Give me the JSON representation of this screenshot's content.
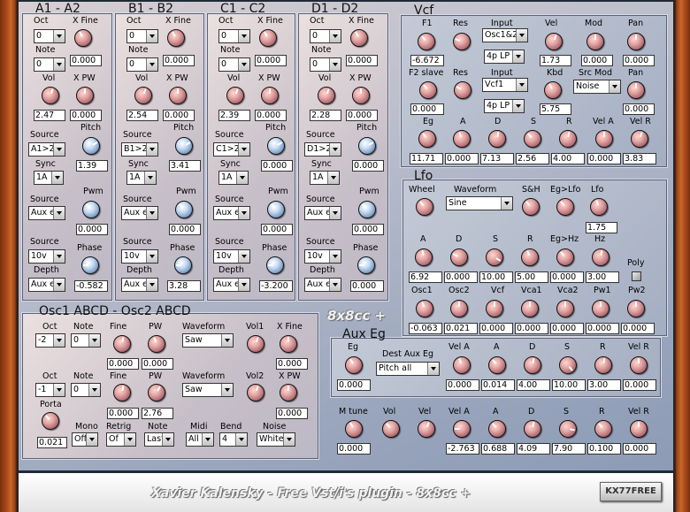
{
  "modules": [
    {
      "title": "A1 - A2",
      "oct": "0",
      "xfine_label": "X Fine",
      "note_label": "Note",
      "note": "0",
      "xfine": "0.000",
      "vol_label": "Vol",
      "xpw_label": "X PW",
      "vol": "2.47",
      "xpw": "0.000",
      "source_label": "Source",
      "source1": "A1>2",
      "pitch_label": "Pitch",
      "pitch": "1.39",
      "sync_label": "Sync",
      "sync": "1A",
      "source2": "Aux e",
      "pwm_label": "Pwm",
      "pwm": "0.000",
      "source3": "10v",
      "phase_label": "Phase",
      "depth_label": "Depth",
      "depth": "Aux e",
      "phase": "-0.582"
    },
    {
      "title": "B1 - B2",
      "oct": "0",
      "xfine_label": "X Fine",
      "note_label": "Note",
      "note": "0",
      "xfine": "0.000",
      "vol_label": "Vol",
      "xpw_label": "X PW",
      "vol": "2.54",
      "xpw": "0.000",
      "source_label": "Source",
      "source1": "B1>2",
      "pitch_label": "Pitch",
      "pitch": "3.41",
      "sync_label": "Sync",
      "sync": "1A",
      "source2": "Aux e",
      "pwm_label": "Pwm",
      "pwm": "0.000",
      "source3": "10v",
      "phase_label": "Phase",
      "depth_label": "Depth",
      "depth": "Aux e",
      "phase": "3.28"
    },
    {
      "title": "C1 - C2",
      "oct": "0",
      "xfine_label": "X Fine",
      "note_label": "Note",
      "note": "0",
      "xfine": "0.000",
      "vol_label": "Vol",
      "xpw_label": "X PW",
      "vol": "2.39",
      "xpw": "0.000",
      "source_label": "Source",
      "source1": "C1>2",
      "pitch_label": "Pitch",
      "pitch": "0.000",
      "sync_label": "Sync",
      "sync": "1A",
      "source2": "Aux e",
      "pwm_label": "Pwm",
      "pwm": "0.000",
      "source3": "10v",
      "phase_label": "Phase",
      "depth_label": "Depth",
      "depth": "Aux e",
      "phase": "-3.200"
    },
    {
      "title": "D1 - D2",
      "oct": "0",
      "xfine_label": "X Fine",
      "note_label": "Note",
      "note": "0",
      "xfine": "0.000",
      "vol_label": "Vol",
      "xpw_label": "X PW",
      "vol": "2.28",
      "xpw": "0.000",
      "source_label": "Source",
      "source1": "D1>2",
      "pitch_label": "Pitch",
      "pitch": "0.000",
      "sync_label": "Sync",
      "sync": "1A",
      "source2": "Aux e",
      "pwm_label": "Pwm",
      "pwm": "0.000",
      "source3": "10v",
      "phase_label": "Phase",
      "depth_label": "Depth",
      "depth": "Aux e",
      "phase": "0.000"
    }
  ],
  "oct_label": "Oct",
  "osc": {
    "title": "Osc1 ABCD - Osc2 ABCD",
    "oct_label": "Oct",
    "note_label": "Note",
    "fine_label": "Fine",
    "pw_label": "PW",
    "waveform_label": "Waveform",
    "vol1_label": "Vol1",
    "xfine_label": "X Fine",
    "oct1": "-2",
    "note1": "0",
    "fine1": "0.000",
    "pw1": "0.000",
    "waveform1": "Saw",
    "xfine": "0.000",
    "oct2": "-1",
    "note2": "0",
    "fine2": "0.000",
    "pw2": "2.76",
    "waveform2": "Saw",
    "vol2_label": "Vol2",
    "xpw_label": "X PW",
    "xpw": "0.000",
    "porta_label": "Porta",
    "porta": "0.021",
    "mono_label": "Mono",
    "mono": "Off",
    "retrig_label": "Retrig",
    "retrig": "Of",
    "note_prio_label": "Note",
    "note_prio": "Last",
    "midi_label": "Midi",
    "midi": "All",
    "bend_label": "Bend",
    "bend": "4",
    "noise_label": "Noise",
    "noise": "White"
  },
  "vcf": {
    "title": "Vcf",
    "f1_label": "F1",
    "res_label": "Res",
    "input_label": "Input",
    "vel_label": "Vel",
    "mod_label": "Mod",
    "pan_label": "Pan",
    "input1": "Osc1&2",
    "type1": "4p LP",
    "f1": "-6.672",
    "vel": "1.73",
    "mod": "0.000",
    "pan": "0.000",
    "f2_label": "F2 slave",
    "res2_label": "Res",
    "input2_label": "Input",
    "input2": "Vcf1",
    "kbd_label": "Kbd",
    "srcmod_label": "Src Mod",
    "srcmod": "Noise",
    "pan2_label": "Pan",
    "type2": "4p LP",
    "f2": "0.000",
    "kbd": "5.75",
    "pan2": "0.000",
    "eg_label": "Eg",
    "a_label": "A",
    "d_label": "D",
    "s_label": "S",
    "r_label": "R",
    "vela_label": "Vel A",
    "velr_label": "Vel R",
    "eg": "11.71",
    "a": "0.000",
    "d": "7.13",
    "s": "2.56",
    "r": "4.00",
    "vela": "0.000",
    "velr": "3.83"
  },
  "lfo": {
    "title": "Lfo",
    "wheel_label": "Wheel",
    "waveform_label": "Waveform",
    "waveform": "Sine",
    "sh_label": "S&H",
    "eglfo_label": "Eg>Lfo",
    "lfo_label": "Lfo",
    "lfo": "1.75",
    "a_label": "A",
    "d_label": "D",
    "s_label": "S",
    "r_label": "R",
    "eghz_label": "Eg>Hz",
    "hz_label": "Hz",
    "poly_label": "Poly",
    "a": "6.92",
    "d": "0.000",
    "s": "10.00",
    "r": "5.00",
    "eghz": "0.000",
    "hz": "3.00",
    "osc1_label": "Osc1",
    "osc2_label": "Osc2",
    "vcf_label": "Vcf",
    "vca1_label": "Vca1",
    "vca2_label": "Vca2",
    "pw1_label": "Pw1",
    "pw2_label": "Pw2",
    "osc1": "-0.063",
    "osc2": "0.021",
    "vcf": "0.000",
    "vca1": "0.000",
    "vca2": "0.000",
    "pw1": "0.000",
    "pw2": "0.000"
  },
  "brand": "8x8cc +",
  "aux": {
    "title": "Aux Eg",
    "eg_label": "Eg",
    "dest_label": "Dest Aux Eg",
    "dest": "Pitch all",
    "vela_label": "Vel A",
    "a_label": "A",
    "d_label": "D",
    "s_label": "S",
    "r_label": "R",
    "velr_label": "Vel R",
    "eg": "0.000",
    "vela": "0.000",
    "a": "0.014",
    "d": "4.00",
    "s": "10.00",
    "r": "3.00",
    "velr": "0.000"
  },
  "master": {
    "mtune_label": "M tune",
    "vol_label": "Vol",
    "vel_label": "Vel",
    "vela_label": "Vel A",
    "a_label": "A",
    "d_label": "D",
    "s_label": "S",
    "r_label": "R",
    "velr_label": "Vel R",
    "mtune": "0.000",
    "vela": "-2.763",
    "a": "0.688",
    "d": "4.09",
    "s": "7.90",
    "r": "0.100",
    "velr": "0.000"
  },
  "footer": {
    "text": "Xavier Kalensky - Free Vst/i's plugin - 8x8cc +",
    "logo": "KX77FREE"
  }
}
